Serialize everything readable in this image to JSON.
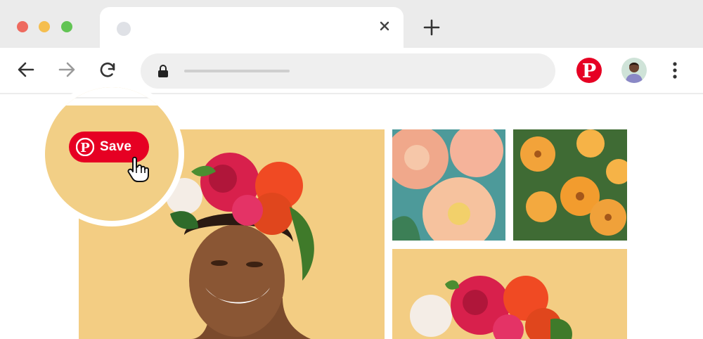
{
  "browser": {
    "tab": {
      "close_icon": "close-icon",
      "favicon": "favicon-placeholder"
    },
    "new_tab_icon": "plus-icon",
    "nav": {
      "back_icon": "arrow-left-icon",
      "forward_icon": "arrow-right-icon",
      "reload_icon": "reload-icon"
    },
    "address_bar": {
      "lock_icon": "lock-icon"
    },
    "extensions": {
      "pinterest_icon": "pinterest-logo-icon",
      "profile": "avatar",
      "menu_icon": "kebab-menu-icon"
    }
  },
  "save_button": {
    "label": "Save",
    "icon": "pinterest-logo-icon"
  },
  "colors": {
    "pinterest_red": "#e60023",
    "tab_strip": "#ebebeb",
    "omnibox": "#efefef",
    "photo_background": "#f2cf86"
  }
}
